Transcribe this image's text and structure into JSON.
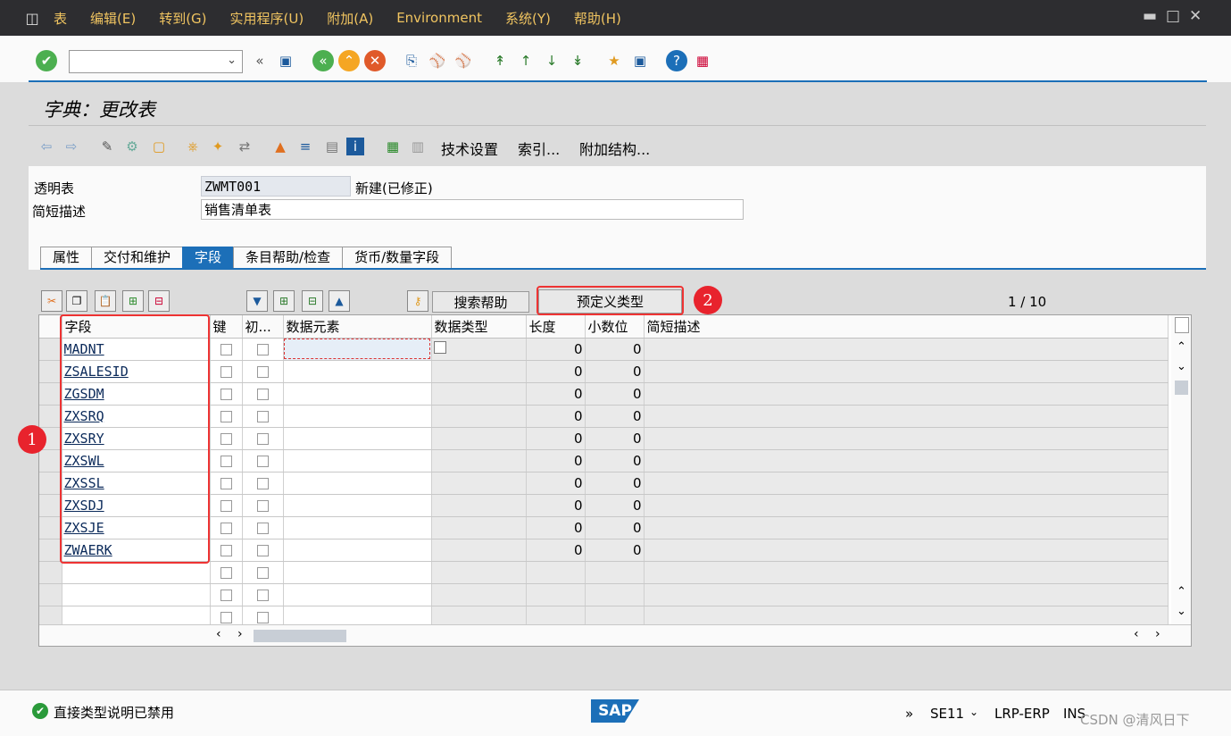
{
  "menu": [
    "表",
    "编辑(E)",
    "转到(G)",
    "实用程序(U)",
    "附加(A)",
    "Environment",
    "系统(Y)",
    "帮助(H)"
  ],
  "title": "字典：更改表",
  "app_toolbar": {
    "tech_settings": "技术设置",
    "index": "索引...",
    "append_struct": "附加结构..."
  },
  "header": {
    "table_label": "透明表",
    "table_value": "ZWMT001",
    "status": "新建(已修正)",
    "desc_label": "简短描述",
    "desc_value": "销售清单表"
  },
  "tabs": [
    "属性",
    "交付和维护",
    "字段",
    "条目帮助/检查",
    "货币/数量字段"
  ],
  "active_tab": 2,
  "grid_toolbar": {
    "search_help": "搜索帮助",
    "predef_type": "预定义类型",
    "pager": "1 / 10"
  },
  "columns": [
    "字段",
    "键",
    "初...",
    "数据元素",
    "数据类型",
    "长度",
    "小数位",
    "简短描述"
  ],
  "rows": [
    {
      "field": "MADNT",
      "len": "0",
      "dec": "0"
    },
    {
      "field": "ZSALESID",
      "len": "0",
      "dec": "0"
    },
    {
      "field": "ZGSDM",
      "len": "0",
      "dec": "0"
    },
    {
      "field": "ZXSRQ",
      "len": "0",
      "dec": "0"
    },
    {
      "field": "ZXSRY",
      "len": "0",
      "dec": "0"
    },
    {
      "field": "ZXSWL",
      "len": "0",
      "dec": "0"
    },
    {
      "field": "ZXSSL",
      "len": "0",
      "dec": "0"
    },
    {
      "field": "ZXSDJ",
      "len": "0",
      "dec": "0"
    },
    {
      "field": "ZXSJE",
      "len": "0",
      "dec": "0"
    },
    {
      "field": "ZWAERK",
      "len": "0",
      "dec": "0"
    }
  ],
  "empty_rows": 3,
  "annotations": [
    "1",
    "2"
  ],
  "status": {
    "message": "直接类型说明已禁用",
    "tcode": "SE11",
    "system": "LRP-ERP",
    "mode": "INS",
    "sap_logo": "SAP",
    "watermark": "CSDN @清风日下"
  }
}
